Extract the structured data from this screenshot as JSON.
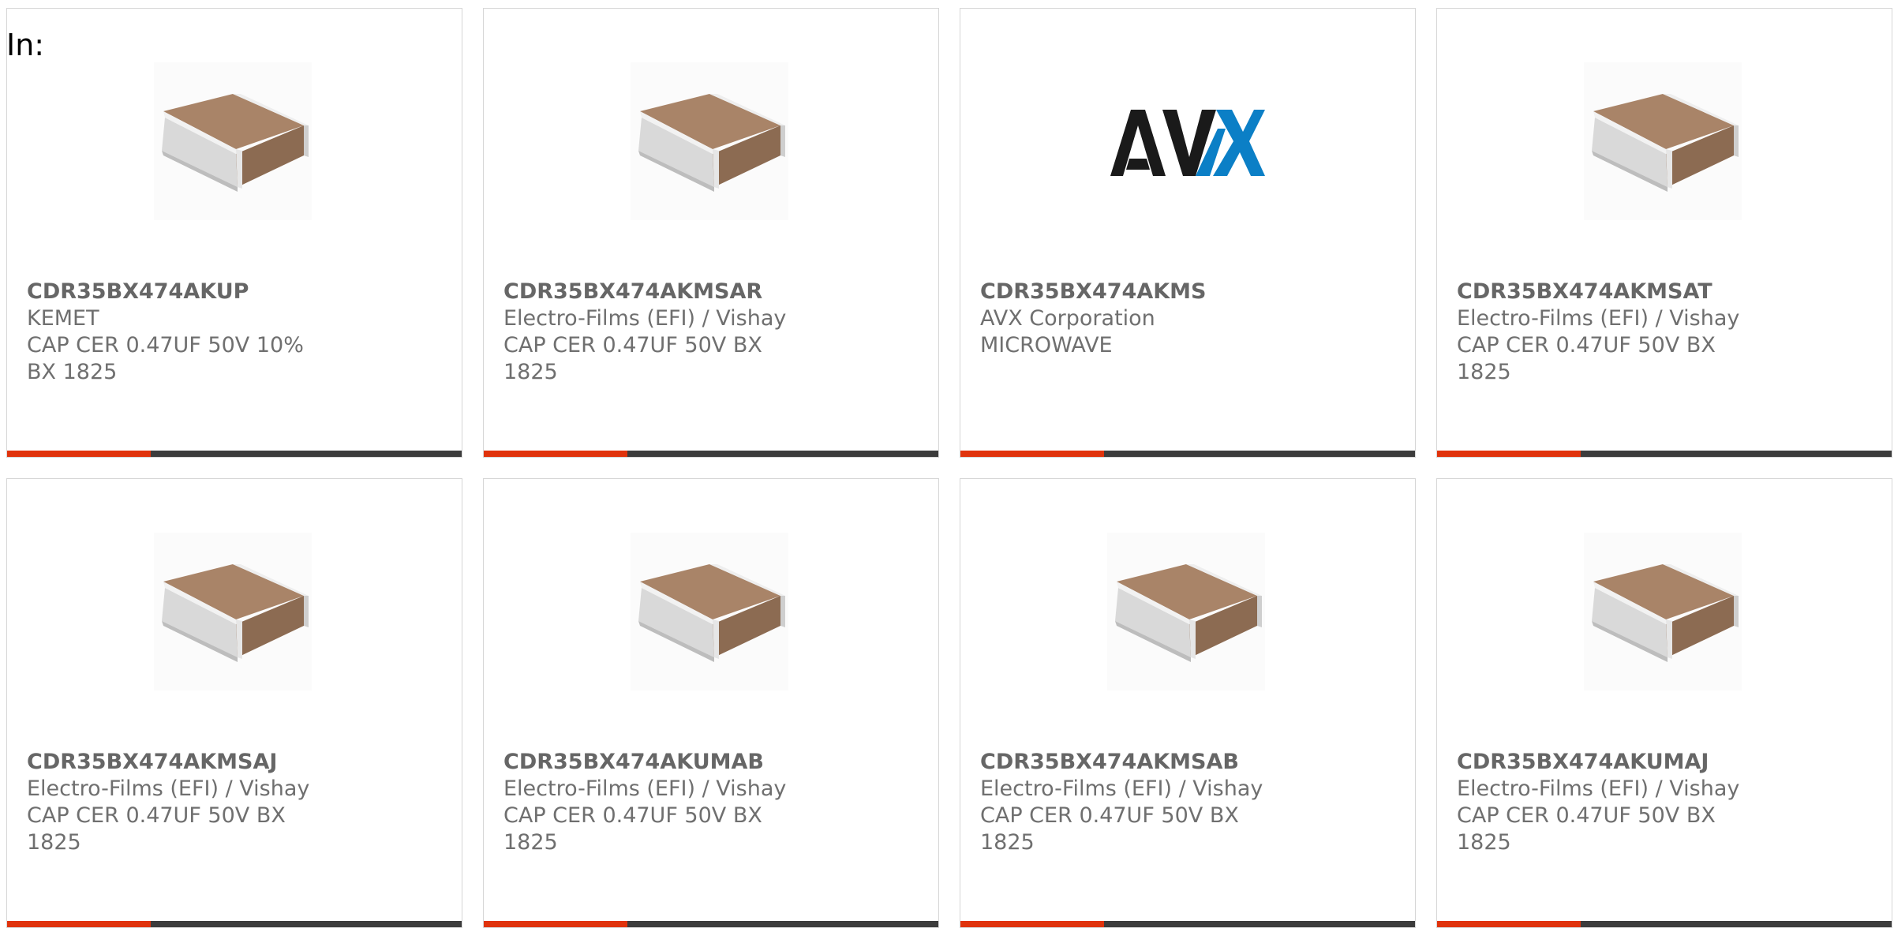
{
  "prefix_label": "In:",
  "colors": {
    "accent": "#e0330c",
    "bar": "#3c3c3c",
    "text": "#6f6f6f",
    "avx_black": "#1a1a1a",
    "avx_blue": "#0b7fc6"
  },
  "products": [
    {
      "part": "CDR35BX474AKUP",
      "maker": "KEMET",
      "desc": "CAP CER 0.47UF 50V 10% BX 1825",
      "image": "chip-capacitor-image"
    },
    {
      "part": "CDR35BX474AKMSAR",
      "maker": "Electro-Films (EFI) / Vishay",
      "desc": "CAP CER 0.47UF 50V BX 1825",
      "image": "chip-capacitor-image"
    },
    {
      "part": "CDR35BX474AKMS",
      "maker": "AVX Corporation",
      "desc": "MICROWAVE",
      "image": "avx-logo",
      "logo_text": "AVX"
    },
    {
      "part": "CDR35BX474AKMSAT",
      "maker": "Electro-Films (EFI) / Vishay",
      "desc": "CAP CER 0.47UF 50V BX 1825",
      "image": "chip-capacitor-image"
    },
    {
      "part": "CDR35BX474AKMSAJ",
      "maker": "Electro-Films (EFI) / Vishay",
      "desc": "CAP CER 0.47UF 50V BX 1825",
      "image": "chip-capacitor-image"
    },
    {
      "part": "CDR35BX474AKUMAB",
      "maker": "Electro-Films (EFI) / Vishay",
      "desc": "CAP CER 0.47UF 50V BX 1825",
      "image": "chip-capacitor-image"
    },
    {
      "part": "CDR35BX474AKMSAB",
      "maker": "Electro-Films (EFI) / Vishay",
      "desc": "CAP CER 0.47UF 50V BX 1825",
      "image": "chip-capacitor-image"
    },
    {
      "part": "CDR35BX474AKUMAJ",
      "maker": "Electro-Films (EFI) / Vishay",
      "desc": "CAP CER 0.47UF 50V BX 1825",
      "image": "chip-capacitor-image"
    }
  ]
}
